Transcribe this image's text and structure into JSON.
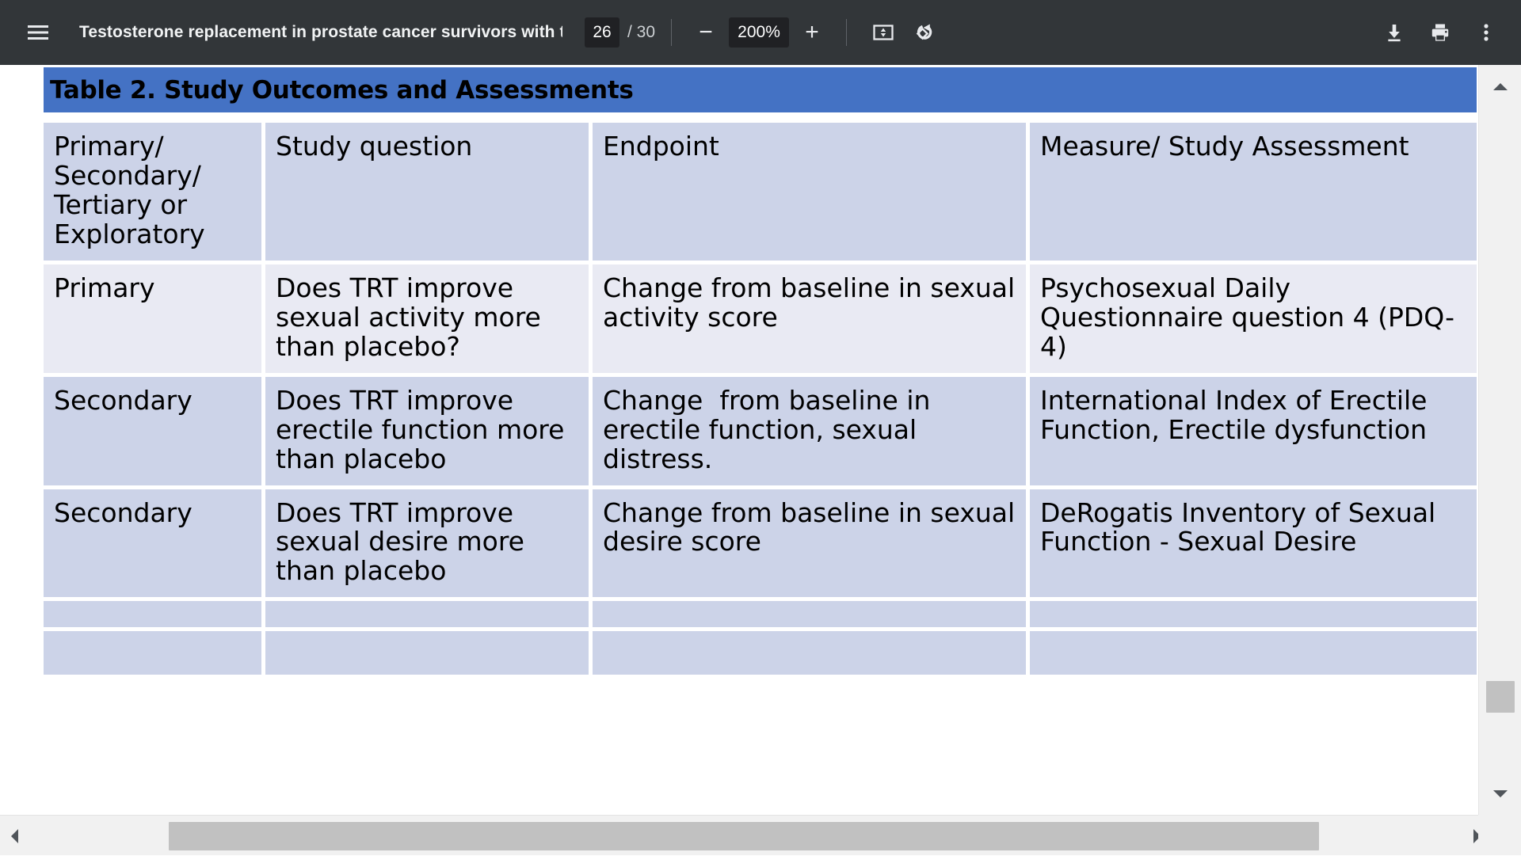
{
  "toolbar": {
    "menu_icon": "hamburger-menu-icon",
    "document_title": "Testosterone replacement in prostate cancer survivors with tes…",
    "page_number": "26",
    "page_count": "/ 30",
    "zoom_out_label": "−",
    "zoom_level": "200%",
    "zoom_in_label": "+",
    "fit_icon": "fit-to-page-icon",
    "rotate_icon": "rotate-counterclockwise-icon",
    "download_icon": "download-icon",
    "print_icon": "print-icon",
    "more_icon": "more-vertical-icon",
    "background_color": "#323639",
    "field_background_color": "#202124"
  },
  "document": {
    "table_title": "Table 2. Study Outcomes and Assessments",
    "title_banner_color": "#4472c4",
    "header_row_color": "#ccd3e8",
    "light_row_color": "#e9eaf3",
    "dark_row_color": "#ccd3e8",
    "table": {
      "headers": [
        "Primary/ Secondary/ Tertiary or Exploratory",
        "Study question",
        "Endpoint",
        "Measure/ Study Assessment"
      ],
      "rows": [
        [
          "Primary",
          "Does TRT improve sexual activity more than placebo?",
          "Change from baseline in sexual activity score",
          "Psychosexual Daily Questionnaire question 4 (PDQ-4)"
        ],
        [
          "Secondary",
          "Does TRT improve erectile function more than placebo",
          "Change  from baseline in erectile function, sexual distress.",
          "International Index of Erectile Function, Erectile dysfunction"
        ],
        [
          "Secondary",
          "Does TRT improve sexual desire more than placebo",
          "Change from baseline in sexual desire score",
          "DeRogatis Inventory of Sexual Function - Sexual Desire"
        ],
        [
          "",
          "",
          "",
          ""
        ],
        [
          "",
          "",
          "",
          ""
        ]
      ]
    }
  },
  "scrollbars": {
    "vertical_up_icon": "scroll-up-arrow-icon",
    "vertical_down_icon": "scroll-down-arrow-icon",
    "horizontal_left_icon": "scroll-left-arrow-icon",
    "horizontal_right_icon": "scroll-right-arrow-icon",
    "track_color": "#f1f1f1",
    "thumb_color": "#c1c1c1"
  }
}
